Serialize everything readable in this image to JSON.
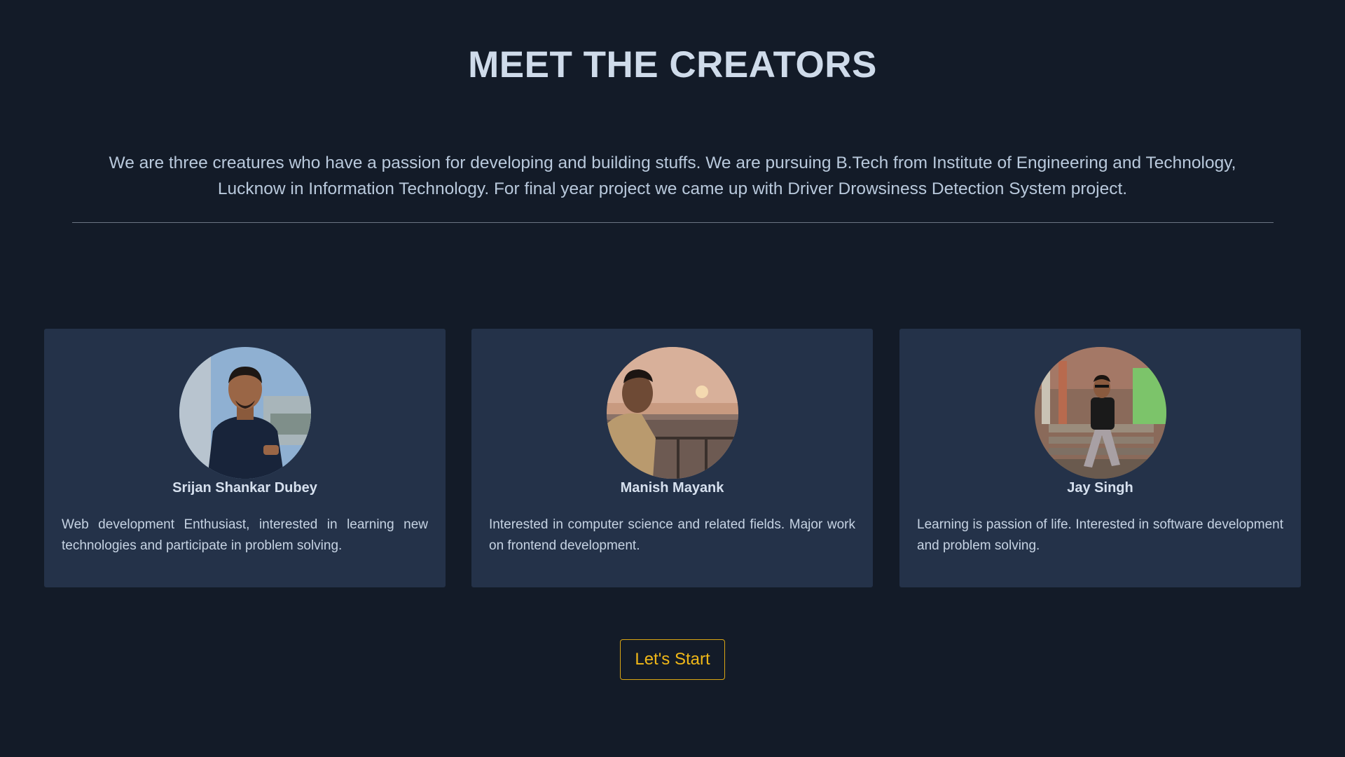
{
  "header": {
    "title": "MEET THE CREATORS",
    "intro": "We are three creatures who have a passion for developing and building stuffs. We are pursuing B.Tech from Institute of Engineering and Technology, Lucknow in Information Technology. For final year project we came up with Driver Drowsiness Detection System project."
  },
  "creators": [
    {
      "name": "Srijan Shankar Dubey",
      "bio": "Web development Enthusiast, interested in learning new technologies and participate in problem solving."
    },
    {
      "name": "Manish Mayank",
      "bio": "Interested in computer science and related fields. Major work on frontend development."
    },
    {
      "name": "Jay Singh",
      "bio": "Learning is passion of life. Interested in software development and problem solving."
    }
  ],
  "cta": {
    "label": "Let's Start"
  },
  "colors": {
    "background": "#131b28",
    "card": "#243249",
    "accent": "#f0b818"
  }
}
